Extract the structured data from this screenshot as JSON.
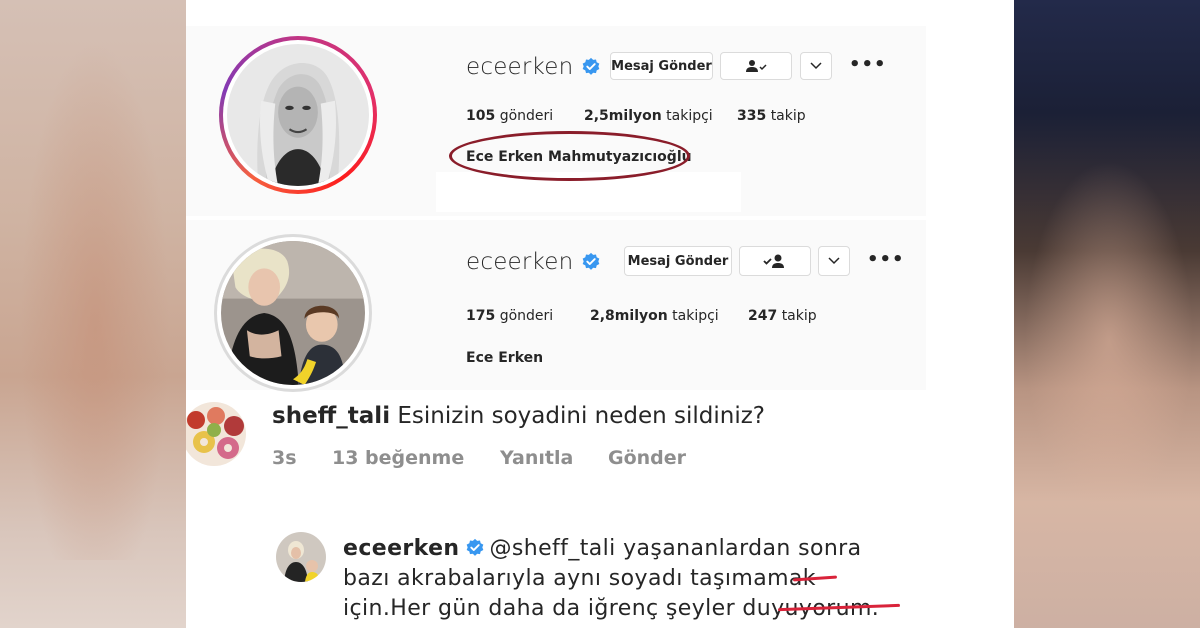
{
  "profile_old": {
    "username": "eceerken",
    "message_button": "Mesaj Gönder",
    "posts_count": "105",
    "posts_label": "gönderi",
    "followers_count": "2,5milyon",
    "followers_label": "takipçi",
    "following_count": "335",
    "following_label": "takip",
    "full_name": "Ece Erken Mahmutyazıcıoğlu"
  },
  "profile_new": {
    "username": "eceerken",
    "message_button": "Mesaj Gönder",
    "posts_count": "175",
    "posts_label": "gönderi",
    "followers_count": "2,8milyon",
    "followers_label": "takipçi",
    "following_count": "247",
    "following_label": "takip",
    "full_name": "Ece Erken"
  },
  "comment": {
    "username": "sheff_tali",
    "text": "Esinizin soyadini neden sildiniz?",
    "time": "3s",
    "likes": "13 beğenme",
    "reply_label": "Yanıtla",
    "send_label": "Gönder"
  },
  "reply": {
    "username": "eceerken",
    "mention": "@sheff_tali",
    "line1": "yaşananlardan sonra",
    "line2": "bazı akrabalarıyla aynı soyadı taşımamak",
    "line3": "için.Her gün daha da iğrenç şeyler duyuyorum."
  },
  "colors": {
    "verified_blue": "#3897f0",
    "highlight_red": "#8a1d2a",
    "meta_gray": "#8e8e8e"
  },
  "icons": [
    "verified-badge-icon",
    "following-person-icon",
    "chevron-down-icon",
    "more-options-icon"
  ]
}
